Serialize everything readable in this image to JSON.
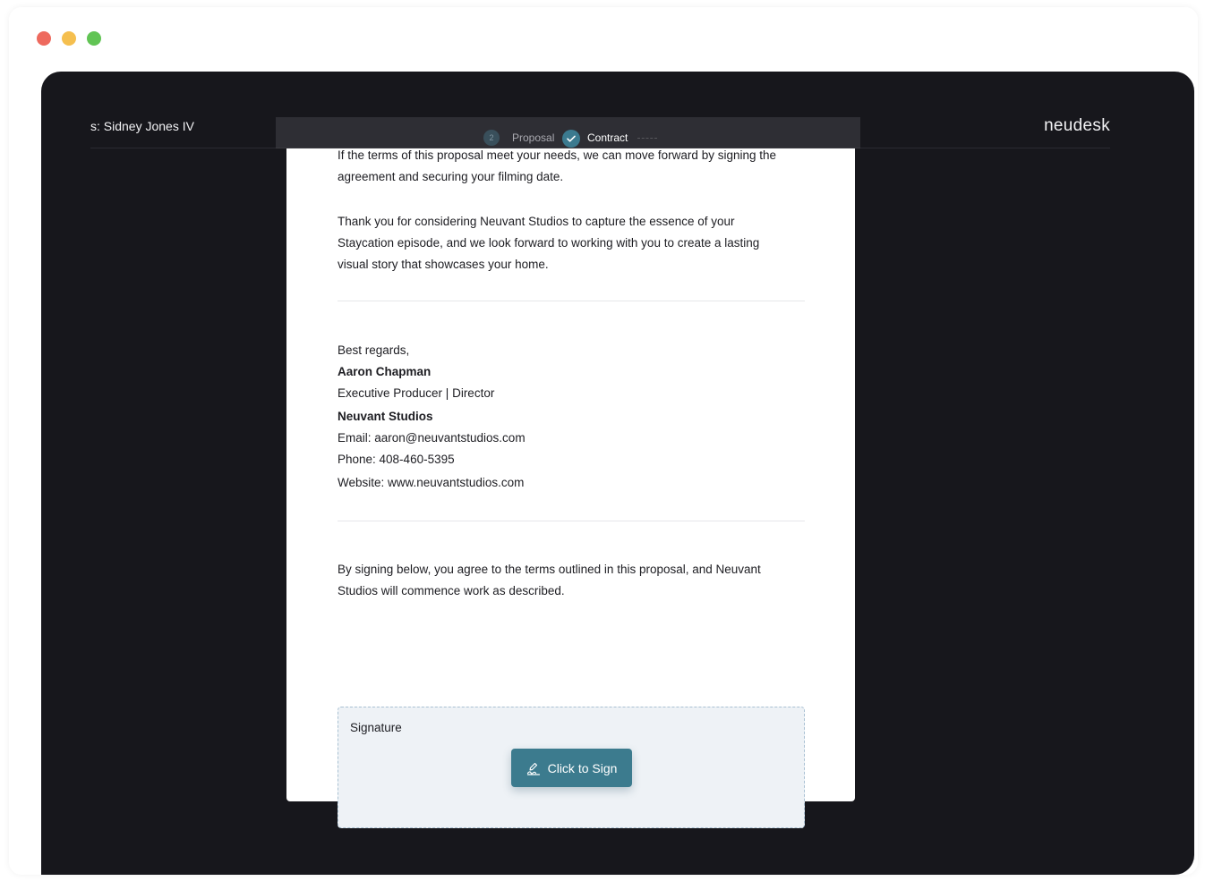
{
  "window": {
    "traffic_lights": [
      "close",
      "minimize",
      "maximize"
    ],
    "colors": {
      "close": "#ee6a5e",
      "minimize": "#f5bf4f",
      "maximize": "#61c454"
    }
  },
  "header": {
    "client_label": "s: Sidney Jones IV",
    "brand": "neudesk"
  },
  "stepper": {
    "step_number": "2",
    "step1_label": "Proposal",
    "step2_label": "Contract",
    "accent": "#3b7a8f"
  },
  "document": {
    "intro_line1": "If the terms of this proposal meet your needs, we can move forward by signing the",
    "intro_line2": "agreement and securing your filming date.",
    "thanks_line1": "Thank you for considering Neuvant Studios to capture the essence of your",
    "thanks_line2": "Staycation episode, and we look forward to working with you to create a lasting",
    "thanks_line3": "visual story that showcases your home.",
    "closing": "Best regards,",
    "sender_name": "Aaron Chapman",
    "sender_title": "Executive Producer | Director",
    "company": "Neuvant Studios",
    "email": "Email: aaron@neuvantstudios.com",
    "phone": "Phone: 408-460-5395",
    "website": "Website: www.neuvantstudios.com",
    "agree_line1": "By signing below, you agree to the terms outlined in this proposal, and Neuvant",
    "agree_line2": "Studios will commence work as described."
  },
  "signature": {
    "label": "Signature",
    "button_label": "Click to Sign",
    "button_color": "#3c7b8e"
  }
}
